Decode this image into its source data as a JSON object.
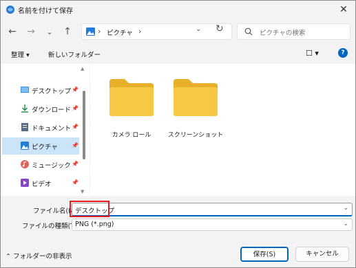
{
  "window": {
    "title": "名前を付けて保存"
  },
  "nav": {
    "back_icon": "←",
    "forward_icon": "→",
    "recent_icon": "⌄",
    "up_icon": "↑",
    "breadcrumb_sep": "›",
    "breadcrumb": [
      "ピクチャ"
    ],
    "refresh_icon": "↻",
    "search_placeholder": "ピクチャの検索"
  },
  "toolbar": {
    "organize": "整理 ▾",
    "new_folder": "新しいフォルダー",
    "view_icon": "☐ ▾",
    "help": "?"
  },
  "sidebar": {
    "items": [
      {
        "label": "デスクトップ",
        "icon": "desktop-icon",
        "pinned": true
      },
      {
        "label": "ダウンロード",
        "icon": "download-icon",
        "pinned": true
      },
      {
        "label": "ドキュメント",
        "icon": "document-icon",
        "pinned": true
      },
      {
        "label": "ピクチャ",
        "icon": "pictures-icon",
        "pinned": true,
        "selected": true
      },
      {
        "label": "ミュージック",
        "icon": "music-icon",
        "pinned": true
      },
      {
        "label": "ビデオ",
        "icon": "video-icon",
        "pinned": true
      }
    ],
    "pin_glyph": "📌"
  },
  "folders": [
    {
      "label": "カメラ ロール"
    },
    {
      "label": "スクリーンショット"
    }
  ],
  "fields": {
    "filename_label": "ファイル名(N):",
    "filename_value": "デスクトップ",
    "filetype_label": "ファイルの種類(T):",
    "filetype_value": "PNG (*.png)"
  },
  "footer": {
    "toggle_label": "フォルダーの非表示",
    "save": "保存(S)",
    "cancel": "キャンセル"
  },
  "colors": {
    "accent": "#0067c0",
    "highlight": "#e8191f",
    "folder": "#f7c844",
    "selected_bg": "#cce4f7"
  }
}
